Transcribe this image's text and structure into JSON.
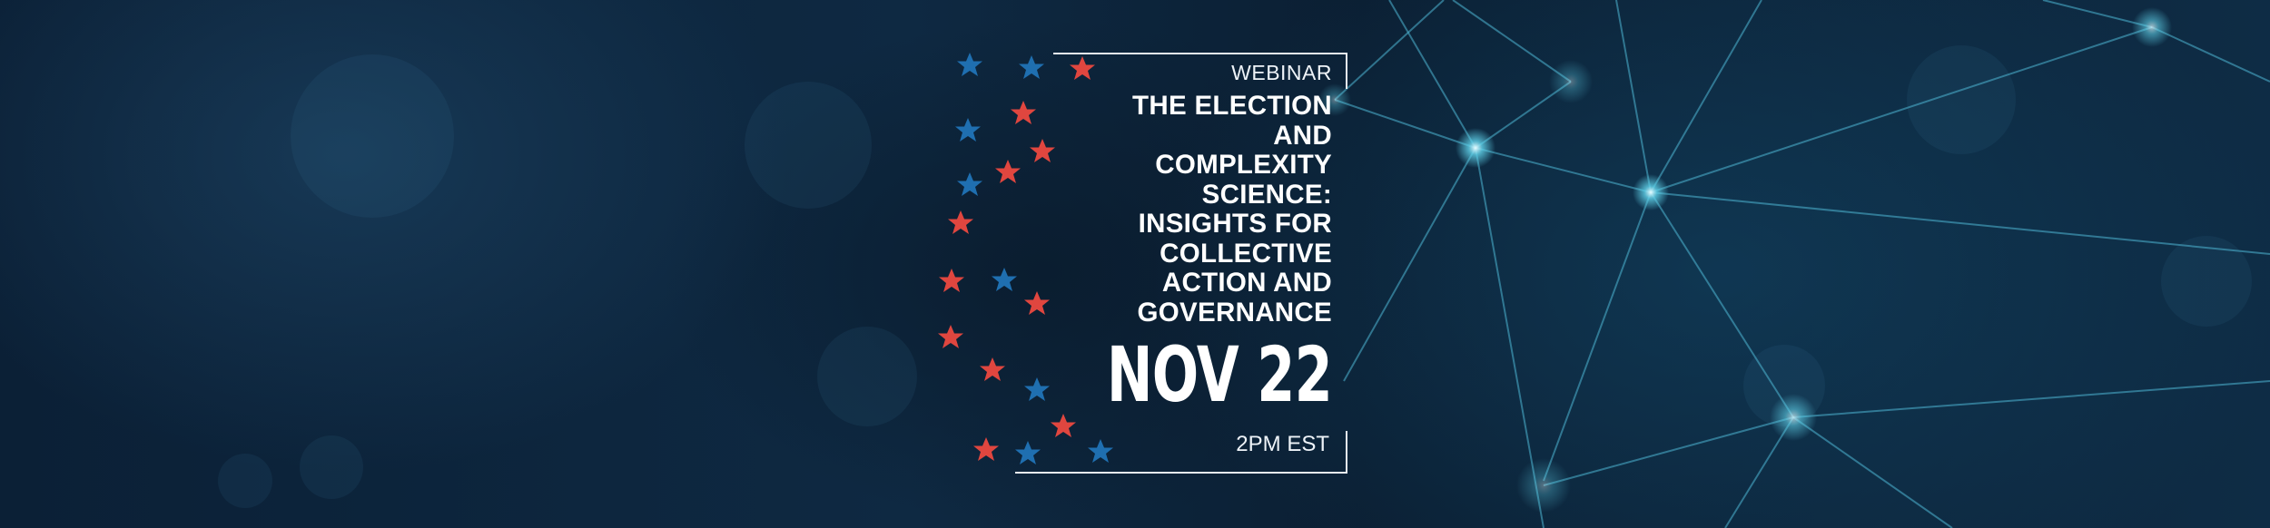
{
  "banner": {
    "eyebrow": "WEBINAR",
    "title_lines": [
      "THE ELECTION",
      "AND",
      "COMPLEXITY",
      "SCIENCE:",
      "INSIGHTS FOR",
      "COLLECTIVE",
      "ACTION AND",
      "GOVERNANCE"
    ],
    "date": "NOV 22",
    "time": "2PM EST"
  },
  "colors": {
    "background": "#0c2238",
    "star_red": "#e0463f",
    "star_blue": "#1f6fb0",
    "text": "#ffffff",
    "network": "#5fd0e8"
  },
  "decorations": {
    "stars": "star-icon",
    "network": "network-nodes"
  }
}
